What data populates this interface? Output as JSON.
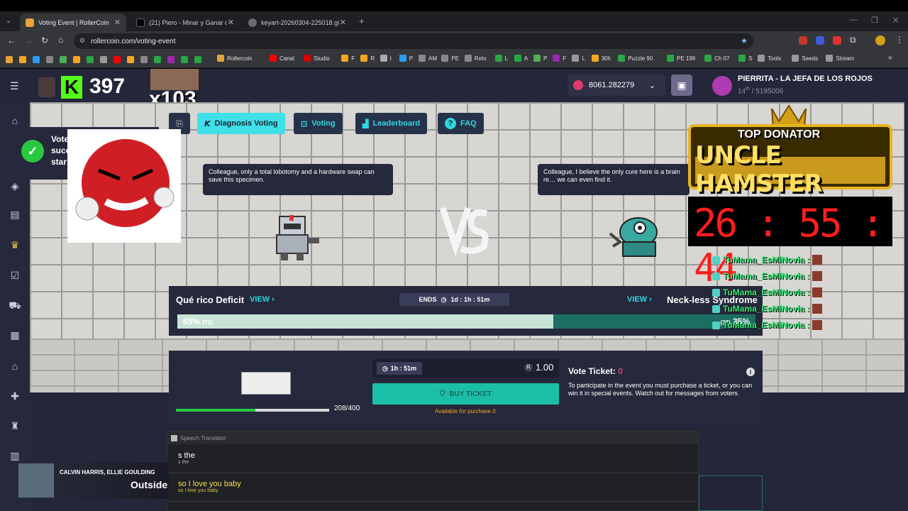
{
  "browser": {
    "tabs": [
      {
        "title": "Voting Event | RollerCoin",
        "active": true,
        "fav": "#e8a23a"
      },
      {
        "title": "(21) Piero - Minar y Ganar on X",
        "active": false,
        "fav": "#000000"
      },
      {
        "title": "keyart-20260304-225018.gif (1…",
        "active": false,
        "fav": "#6a6a6a"
      }
    ],
    "url": "rollercoin.com/voting-event",
    "bookmarks": [
      "Rollercoin",
      "Canal",
      "Studio",
      "F",
      "R",
      "I",
      "P",
      "AM",
      "PE",
      "Reto",
      "L",
      "A",
      "P",
      "F",
      "L",
      "30h",
      "Puzzle 90",
      "PE 199",
      "Ch 07",
      "S",
      "Tools",
      "Seeds",
      "Stream"
    ]
  },
  "header": {
    "kick_count": "397",
    "multiplier": "x103",
    "balance": "8061.282279",
    "username": "PIERRITA - LA JEFA DE LOS ROJOS",
    "rank_num": "14",
    "rank_sup": "th",
    "rank_total": "/ 5195006"
  },
  "nav": {
    "diagnosis": "Diagnosis Voting",
    "voting": "Voting",
    "leaderboard": "Leaderboard",
    "faq": "FAQ"
  },
  "toast": {
    "line1": "Vote",
    "line2": "succ",
    "line3": "star"
  },
  "battle": {
    "left_quote": "Colleague, only a total lobotomy and a hardware swap can save this specimen.",
    "right_quote": "Colleague, I believe the only cure here is a brain re… we can even find it.",
    "left_name": "Qué rico Deficit",
    "right_name": "Neck-less Syndrome",
    "view": "VIEW",
    "ends_label": "ENDS",
    "ends_time": "1d : 1h : 51m",
    "left_pct": "65%",
    "left_votes": "(72)",
    "right_pct": "35%",
    "right_votes": "(38)",
    "left_fraction": 0.65
  },
  "ticket": {
    "timer": "1h : 51m",
    "price": "1.00",
    "buy": "BUY TICKET",
    "available": "Available for purchase 0",
    "progress_text": "208/400",
    "progress_fraction": 0.52,
    "vote_ticket_label": "Vote Ticket:",
    "vote_ticket_count": "0",
    "desc": "To participate in the event you must purchase a ticket, or you can win it in special events. Watch out for messages from voters."
  },
  "overlay": {
    "banner_top": "TOP DONATOR",
    "banner_name": "UNCLE HAMSTER",
    "timer": "26 : 55 : 44",
    "chat_user": "TuMama_EsMiNovia :",
    "chat_count": 5
  },
  "speech": {
    "title": "Speech Translator",
    "lines": [
      {
        "main": "s the",
        "sub": "s the"
      },
      {
        "main": "so I love you baby",
        "sub": "so I love you baby"
      }
    ]
  },
  "music": {
    "artist": "CALVIN HARRIS, ELLIE GOULDING",
    "track": "Outside"
  },
  "colors": {
    "accent": "#3fe0e8",
    "vote_bar_left": "#c9e4d6",
    "vote_bar_right": "#1d6e62",
    "timer_red": "#ff1e1e"
  }
}
